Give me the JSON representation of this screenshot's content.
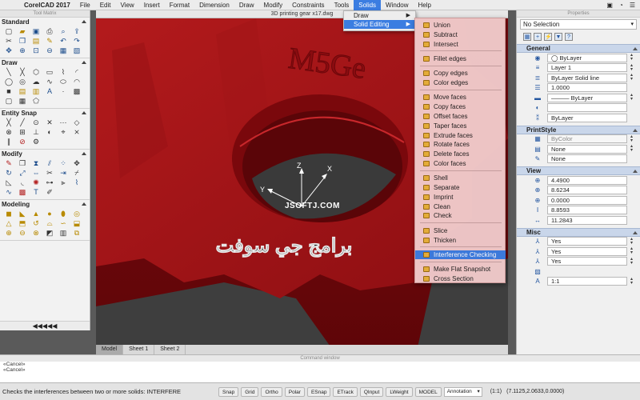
{
  "menubar": {
    "app_name": "CorelCAD 2017",
    "items": [
      "File",
      "Edit",
      "View",
      "Insert",
      "Format",
      "Dimension",
      "Draw",
      "Modify",
      "Constraints",
      "Tools",
      "Solids",
      "Window",
      "Help"
    ],
    "active_item": "Solids"
  },
  "tool_matrix": {
    "title": "Tool Matrix",
    "sections": [
      {
        "name": "Standard",
        "icons": [
          "new-file-icon",
          "open-folder-icon",
          "save-icon",
          "print-icon",
          "print-preview-icon",
          "publish-icon",
          "cut-icon",
          "copy-icon",
          "paste-icon",
          "match-properties-icon",
          "undo-icon",
          "redo-icon",
          "pan-icon",
          "zoom-realtime-icon",
          "zoom-window-icon",
          "zoom-previous-icon",
          "properties-icon",
          "explorer-icon"
        ]
      },
      {
        "name": "Draw",
        "icons": [
          "line-icon",
          "infinite-line-icon",
          "polygon-icon",
          "rectangle-icon",
          "polyline-icon",
          "arc-icon",
          "circle-icon",
          "donut-icon",
          "cloud-icon",
          "spline-icon",
          "ellipse-icon",
          "elliptical-arc-icon",
          "block-icon",
          "insert-block-icon",
          "attach-icon",
          "text-icon",
          "point-icon",
          "hatch-icon",
          "region-icon",
          "table-icon",
          "image-icon"
        ]
      },
      {
        "name": "Entity Snap",
        "icons": [
          "snap-endpoint-icon",
          "snap-midpoint-icon",
          "snap-center-icon",
          "snap-intersection-icon",
          "snap-extension-icon",
          "snap-quadrant-icon",
          "snap-node-icon",
          "snap-insertion-icon",
          "snap-perpendicular-icon",
          "snap-tangent-icon",
          "snap-nearest-icon",
          "snap-apparent-icon",
          "snap-parallel-icon",
          "snap-none-icon",
          "snap-settings-icon"
        ]
      },
      {
        "name": "Modify",
        "icons": [
          "erase-icon",
          "copy-entity-icon",
          "mirror-icon",
          "offset-icon",
          "pattern-icon",
          "move-icon",
          "rotate-icon",
          "scale-icon",
          "stretch-icon",
          "trim-icon",
          "extend-icon",
          "break-icon",
          "chamfer-icon",
          "fillet-icon",
          "explode-icon",
          "weld-icon",
          "align-icon",
          "edit-polyline-icon",
          "edit-spline-icon",
          "edit-hatch-icon",
          "edit-text-icon",
          "edit-attribute-icon"
        ]
      },
      {
        "name": "Modeling",
        "icons": [
          "box-icon",
          "wedge-icon",
          "cone-icon",
          "sphere-icon",
          "cylinder-icon",
          "torus-icon",
          "pyramid-icon",
          "extrude-icon",
          "revolve-icon",
          "loft-icon",
          "sweep-icon",
          "polysolid-icon",
          "union-icon",
          "subtract-icon",
          "intersect-icon",
          "slice-icon",
          "section-icon",
          "interference-icon"
        ]
      }
    ],
    "footer": "◀◀◀◀◀"
  },
  "document": {
    "title": "3D printing gear x17.dwg",
    "tabs": [
      "Model",
      "Sheet 1",
      "Sheet 2"
    ],
    "selected_tab": "Model",
    "watermark_url": "JSOFTJ.COM",
    "watermark_arabic": "برامج جي سوفت",
    "axis_labels": [
      "Z",
      "X",
      "Y"
    ],
    "gear_color": "#a71418"
  },
  "solids_menu": {
    "items": [
      {
        "label": "Draw",
        "submenu": true
      },
      {
        "label": "Solid Editing",
        "submenu": true
      }
    ],
    "selected": "Solid Editing"
  },
  "solid_editing_menu": {
    "groups": [
      [
        "Union",
        "Subtract",
        "Intersect"
      ],
      [
        "Fillet edges"
      ],
      [
        "Copy edges",
        "Color edges"
      ],
      [
        "Move faces",
        "Copy faces",
        "Offset faces",
        "Taper faces",
        "Extrude faces",
        "Rotate faces",
        "Delete faces",
        "Color faces"
      ],
      [
        "Shell",
        "Separate",
        "Imprint",
        "Clean",
        "Check"
      ],
      [
        "Slice",
        "Thicken"
      ],
      [
        "Interference Checking"
      ],
      [
        "Make Flat Snapshot",
        "Cross Section"
      ]
    ],
    "highlighted": "Interference Checking",
    "tint": "#f0caca"
  },
  "properties": {
    "title": "Properties",
    "selection": "No Selection",
    "sections": {
      "general": {
        "label": "General",
        "rows": [
          {
            "icon": "color-icon",
            "value": "◯ ByLayer",
            "dropdown": true
          },
          {
            "icon": "layer-icon",
            "value": "Layer 1",
            "dropdown": true
          },
          {
            "icon": "linestyle-icon",
            "value": "ByLayer     Solid line",
            "dropdown": true
          },
          {
            "icon": "linescale-icon",
            "value": "1.0000",
            "dropdown": false
          },
          {
            "icon": "lineweight-icon",
            "value": "——— ByLayer",
            "dropdown": true
          },
          {
            "icon": "transparency-icon",
            "value": "",
            "dropdown": false
          },
          {
            "icon": "hyperlink-icon",
            "value": "ByLayer",
            "dropdown": false
          }
        ]
      },
      "printstyle": {
        "label": "PrintStyle",
        "rows": [
          {
            "icon": "printstyle-icon",
            "value": "ByColor",
            "dropdown": true,
            "readonly": true
          },
          {
            "icon": "printstyle-table-icon",
            "value": "None",
            "dropdown": true
          },
          {
            "icon": "printstyle-attached-icon",
            "value": "None",
            "dropdown": false
          }
        ]
      },
      "view": {
        "label": "View",
        "rows": [
          {
            "icon": "center-x-icon",
            "value": "4.4900"
          },
          {
            "icon": "center-y-icon",
            "value": "8.6234"
          },
          {
            "icon": "center-z-icon",
            "value": "0.0000"
          },
          {
            "icon": "height-icon",
            "value": "8.8593"
          },
          {
            "icon": "width-icon",
            "value": "11.2843"
          }
        ]
      },
      "misc": {
        "label": "Misc",
        "rows": [
          {
            "icon": "ucs-on-icon",
            "value": "Yes",
            "dropdown": true
          },
          {
            "icon": "ucs-origin-icon",
            "value": "Yes",
            "dropdown": true
          },
          {
            "icon": "ucs-per-viewport-icon",
            "value": "Yes",
            "dropdown": true
          },
          {
            "icon": "ucs-name-icon",
            "value": "",
            "dropdown": false
          },
          {
            "icon": "annotation-scale-icon",
            "value": "1:1",
            "dropdown": true
          }
        ]
      }
    }
  },
  "command_window": {
    "title": "Command window",
    "lines": [
      "«Cancel»",
      "«Cancel»"
    ]
  },
  "statusbar": {
    "message": "Checks the interferences between two or more solids:  INTERFERE",
    "toggles": [
      "Snap",
      "Grid",
      "Ortho",
      "Polar",
      "ESnap",
      "ETrack",
      "QInput",
      "LWeight",
      "MODEL"
    ],
    "annotation": "Annotation",
    "scale": "(1:1)",
    "coordinates": "(7.1125,2.0633,0.0000)"
  }
}
